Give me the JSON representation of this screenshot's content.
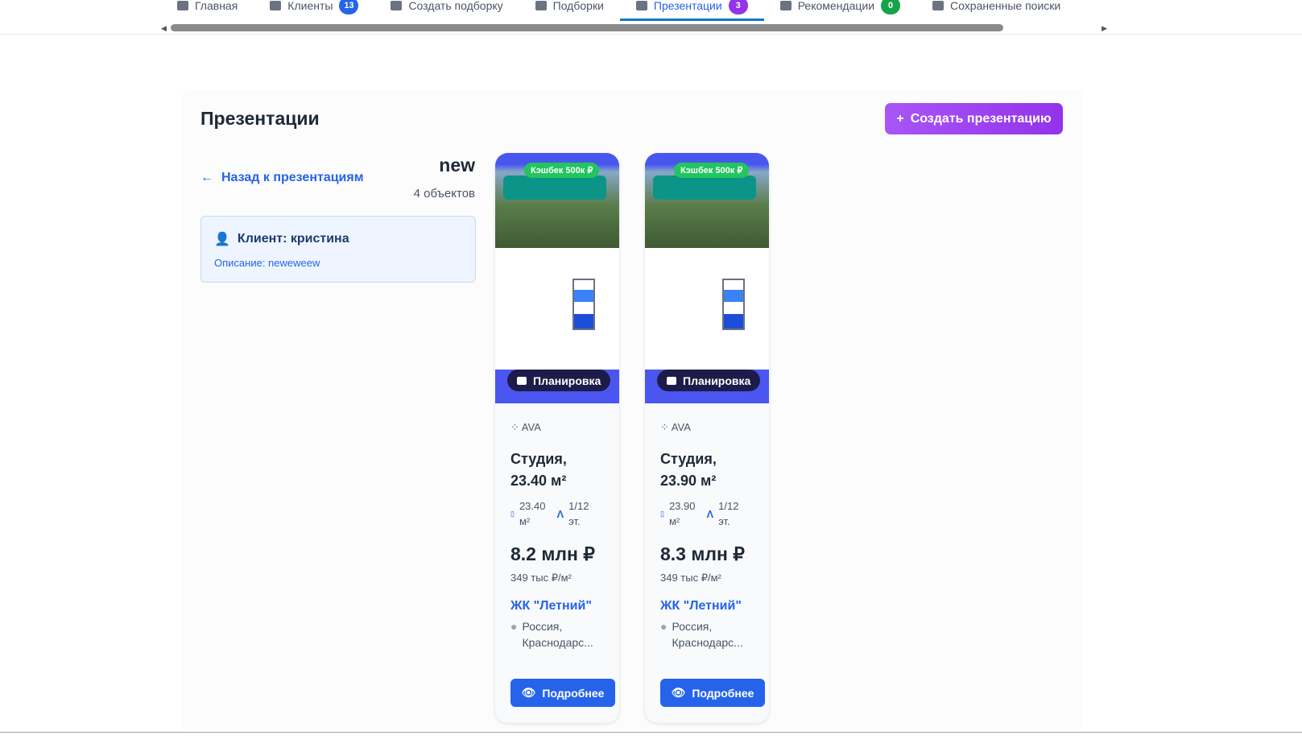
{
  "nav": {
    "tabs": [
      {
        "label": "Главная",
        "icon": "home-icon"
      },
      {
        "label": "Клиенты",
        "badge": "13",
        "badge_color": "#2563eb",
        "icon": "users-icon"
      },
      {
        "label": "Создать подборку",
        "icon": "plus-circle-icon"
      },
      {
        "label": "Подборки",
        "icon": "list-icon"
      },
      {
        "label": "Презентации",
        "badge": "3",
        "badge_color": "#9333ea",
        "icon": "presentation-icon",
        "active": true
      },
      {
        "label": "Рекомендации",
        "badge": "0",
        "badge_color": "#16a34a",
        "icon": "star-icon"
      },
      {
        "label": "Сохраненные поиски",
        "icon": "search-icon"
      }
    ]
  },
  "page": {
    "title": "Презентации",
    "create_label": "Создать презентацию",
    "back_label": "Назад к презентациям"
  },
  "presentation": {
    "name": "new",
    "count": "4 объектов",
    "client": "Клиент: кристина",
    "description": "Описание: neweweew"
  },
  "cards": [
    {
      "cashback": "Кэшбек 500к ₽",
      "plan_label": "Планировка",
      "developer": "AVA",
      "type": "Студия,",
      "area_title": "23.40 м²",
      "area": "23.40",
      "area_unit": "м²",
      "floor": "1/12",
      "floor_unit": "эт.",
      "price": "8.2 млн ₽",
      "ppm": "349 тыс ₽/м²",
      "complex": "ЖК \"Летний\"",
      "addr1": "Россия,",
      "addr2": "Краснодарс...",
      "more": "Подробнее"
    },
    {
      "cashback": "Кэшбек 500к ₽",
      "plan_label": "Планировка",
      "developer": "AVA",
      "type": "Студия,",
      "area_title": "23.90 м²",
      "area": "23.90",
      "area_unit": "м²",
      "floor": "1/12",
      "floor_unit": "эт.",
      "price": "8.3 млн ₽",
      "ppm": "349 тыс ₽/м²",
      "complex": "ЖК \"Летний\"",
      "addr1": "Россия,",
      "addr2": "Краснодарс...",
      "more": "Подробнее"
    }
  ]
}
